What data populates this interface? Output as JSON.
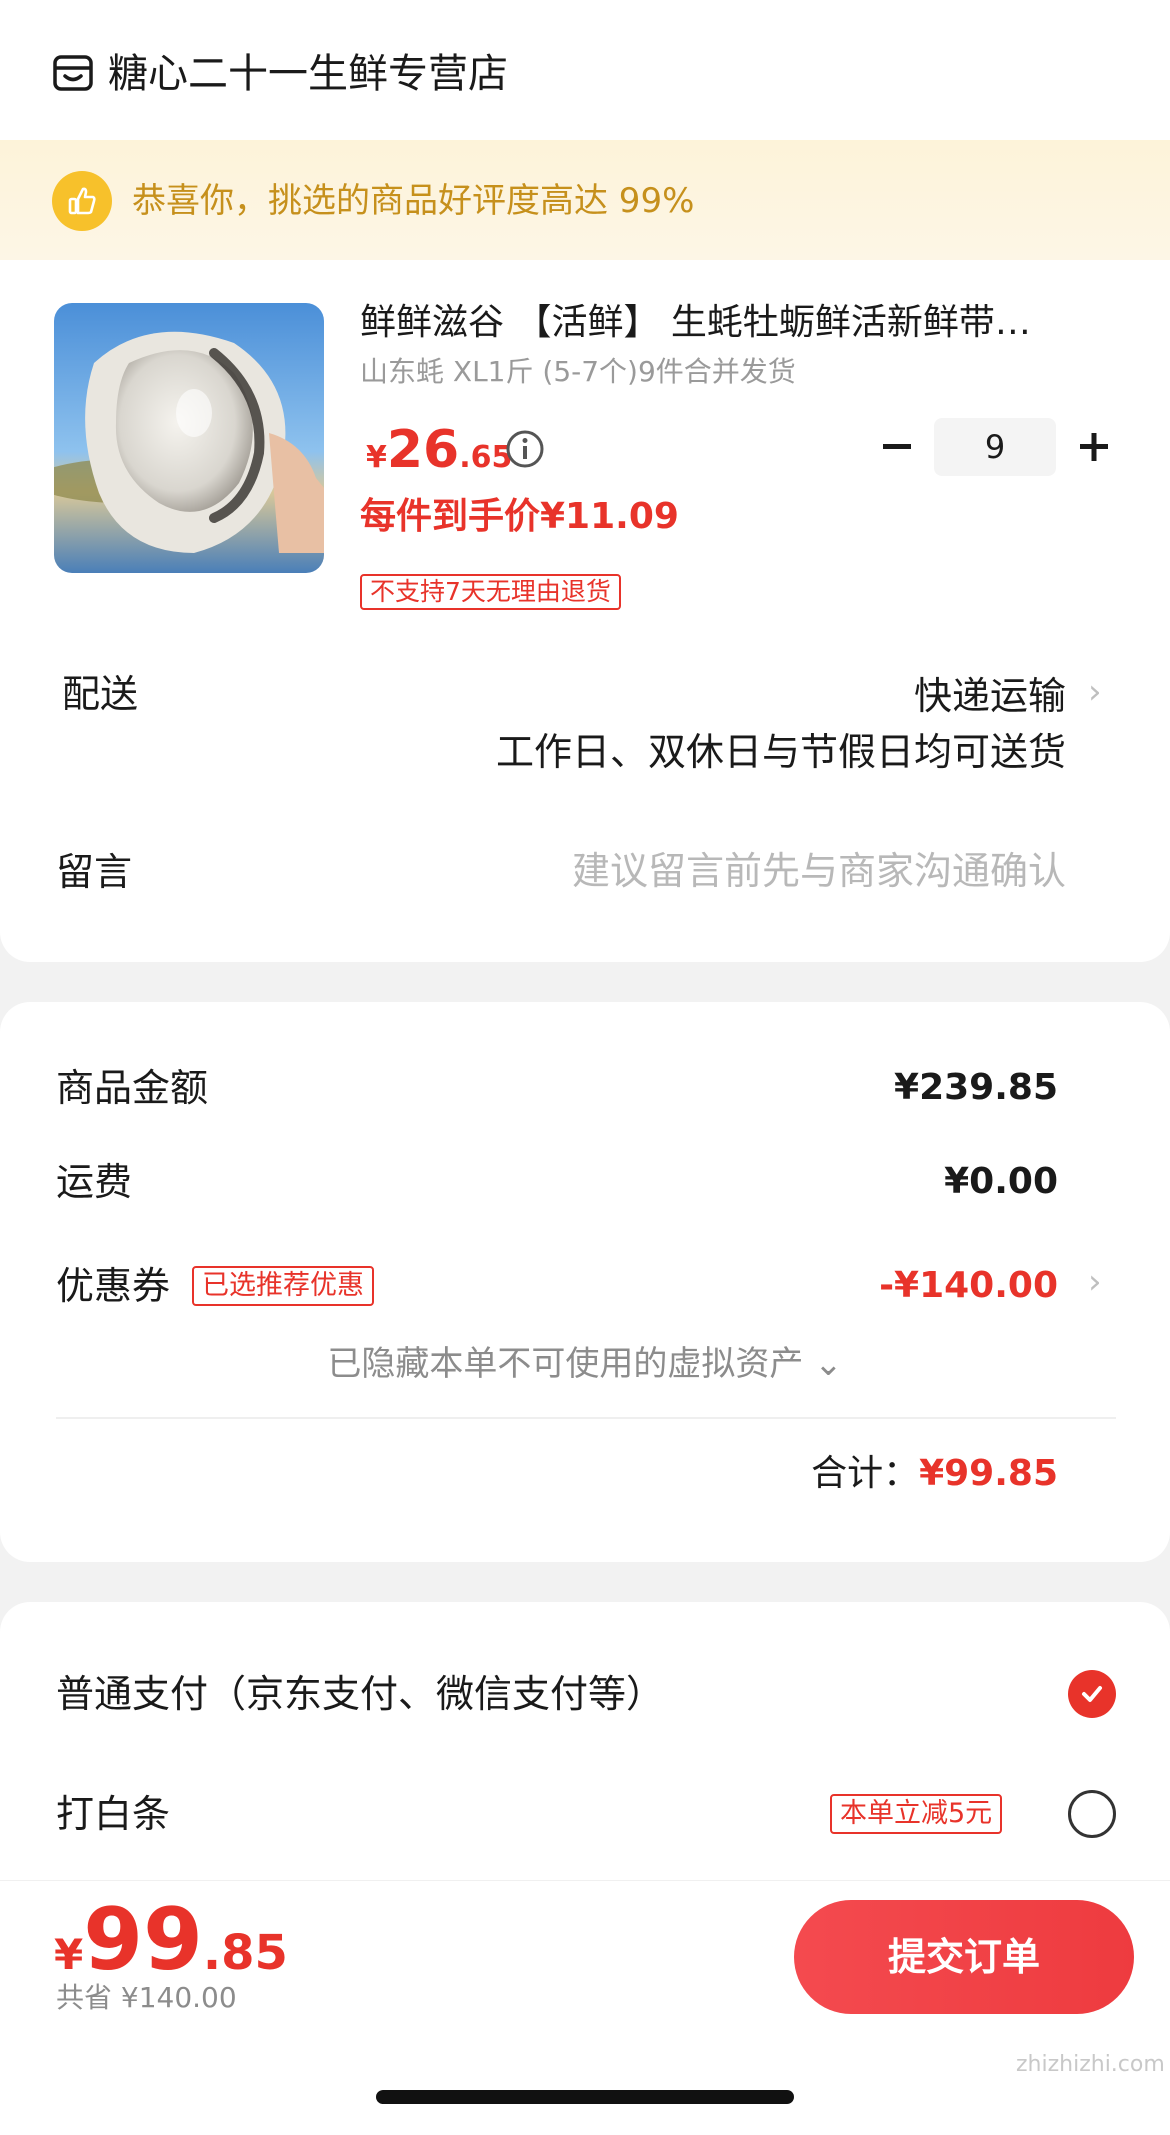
{
  "store": {
    "name": "糖心二十一生鲜专营店",
    "icon": "store-icon"
  },
  "banner": {
    "text": "恭喜你，挑选的商品好评度高达 99%",
    "icon": "thumbs-up-icon"
  },
  "product": {
    "title": "鲜鲜滋谷 【活鲜】 生蚝牡蛎鲜活新鲜带…",
    "spec": "山东蚝 XL1斤 (5-7个)9件合并发货",
    "price_currency": "¥",
    "price_int": "26",
    "price_dec": ".65",
    "unit_price": "每件到手价¥11.09",
    "return_policy": "不支持7天无理由退货",
    "quantity": "9"
  },
  "delivery": {
    "label": "配送",
    "method": "快递运输",
    "note": "工作日、双休日与节假日均可送货"
  },
  "message": {
    "label": "留言",
    "placeholder": "建议留言前先与商家沟通确认"
  },
  "amounts": {
    "goods_label": "商品金额",
    "goods_value": "¥239.85",
    "shipping_label": "运费",
    "shipping_value": "¥0.00",
    "coupon_label": "优惠券",
    "coupon_badge": "已选推荐优惠",
    "coupon_value": "-¥140.00",
    "hidden_assets": "已隐藏本单不可使用的虚拟资产 ⌄",
    "total_label": "合计：",
    "total_value": "¥99.85"
  },
  "payment": {
    "normal_label": "普通支付（京东支付、微信支付等）",
    "baitiao_label": "打白条",
    "baitiao_promo": "本单立减5元"
  },
  "footer": {
    "currency": "¥",
    "total_int": "99",
    "total_dec": ".85",
    "saved": "共省 ¥140.00",
    "submit": "提交订单"
  },
  "watermark": "zhizhizhi.com",
  "colors": {
    "accent": "#e8332a",
    "banner_text": "#c6901c",
    "banner_bg": "#fdf3d9"
  }
}
